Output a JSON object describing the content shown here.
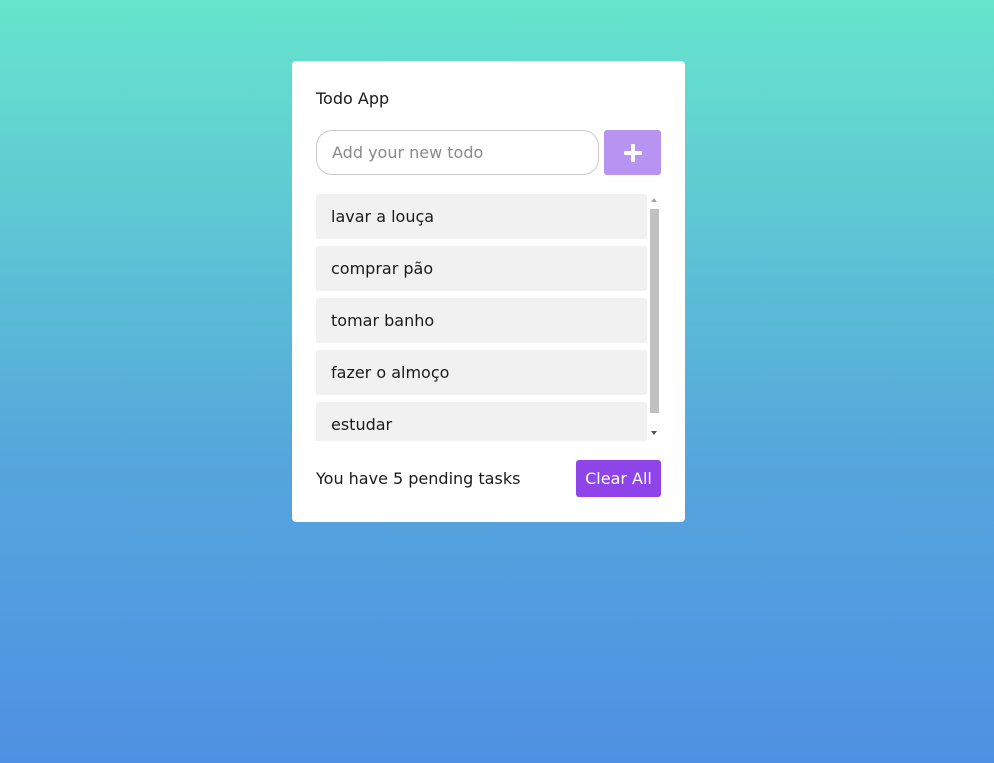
{
  "app": {
    "title": "Todo App"
  },
  "input": {
    "placeholder": "Add your new todo",
    "value": ""
  },
  "add_button": {
    "icon": "plus-icon"
  },
  "todos": [
    "lavar a louça",
    "comprar pão",
    "tomar banho",
    "fazer o almoço",
    "estudar"
  ],
  "footer": {
    "pending_text": "You have 5 pending tasks",
    "clear_label": "Clear All"
  },
  "colors": {
    "background_top": "#66e5cc",
    "background_bottom": "#4e91e3",
    "add_button": "#b794f2",
    "clear_button": "#8e44e8",
    "item_background": "#f1f1f1"
  }
}
